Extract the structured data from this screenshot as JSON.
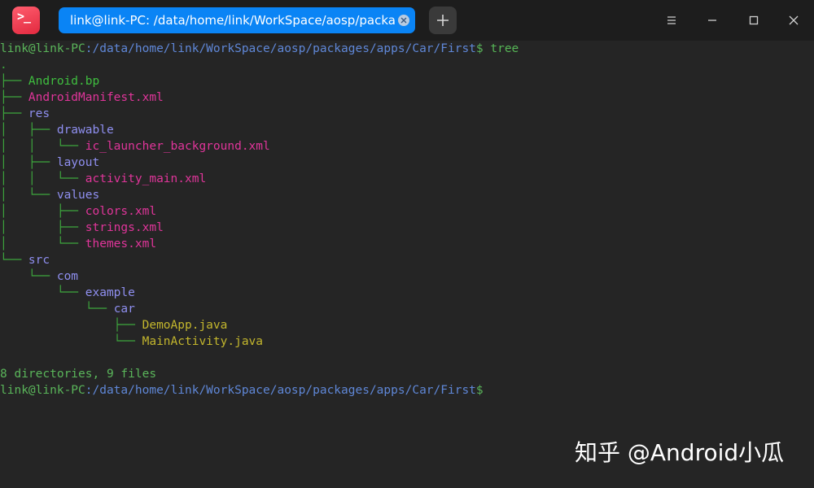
{
  "titlebar": {
    "tab_title": "link@link-PC: /data/home/link/WorkSpace/aosp/packages/a…",
    "app_icon_glyph": ">_",
    "icons": {
      "app": "terminal-icon",
      "tab_close": "close-icon",
      "add_tab": "plus-icon",
      "menu": "menu-icon",
      "minimize": "minimize-icon",
      "maximize": "maximize-icon",
      "close": "close-icon"
    },
    "accent_color": "#0a84f5"
  },
  "terminal": {
    "prompt_user": "link@link-PC",
    "prompt_path": ":/data/home/link/WorkSpace/aosp/packages/apps/Car/First",
    "prompt_symbol": "$",
    "command": " tree",
    "tree_root": ".",
    "tree": [
      {
        "branch": "├── ",
        "name": "Android.bp",
        "kind": "bp"
      },
      {
        "branch": "├── ",
        "name": "AndroidManifest.xml",
        "kind": "xml"
      },
      {
        "branch": "├── ",
        "name": "res",
        "kind": "dir"
      },
      {
        "branch": "│   ├── ",
        "name": "drawable",
        "kind": "dir"
      },
      {
        "branch": "│   │   └── ",
        "name": "ic_launcher_background.xml",
        "kind": "xml"
      },
      {
        "branch": "│   ├── ",
        "name": "layout",
        "kind": "dir"
      },
      {
        "branch": "│   │   └── ",
        "name": "activity_main.xml",
        "kind": "xml"
      },
      {
        "branch": "│   └── ",
        "name": "values",
        "kind": "dir"
      },
      {
        "branch": "│       ├── ",
        "name": "colors.xml",
        "kind": "xml"
      },
      {
        "branch": "│       ├── ",
        "name": "strings.xml",
        "kind": "xml"
      },
      {
        "branch": "│       └── ",
        "name": "themes.xml",
        "kind": "xml"
      },
      {
        "branch": "└── ",
        "name": "src",
        "kind": "dir"
      },
      {
        "branch": "    └── ",
        "name": "com",
        "kind": "dir"
      },
      {
        "branch": "        └── ",
        "name": "example",
        "kind": "dir"
      },
      {
        "branch": "            └── ",
        "name": "car",
        "kind": "dir"
      },
      {
        "branch": "                ├── ",
        "name": "DemoApp.java",
        "kind": "java"
      },
      {
        "branch": "                └── ",
        "name": "MainActivity.java",
        "kind": "java"
      }
    ],
    "summary": "8 directories, 9 files",
    "colors": {
      "user": "#5ab55a",
      "path": "#5f87d7",
      "tree_lines": "#3ea83e",
      "directory": "#8f8ff0",
      "xml": "#e0359a",
      "java": "#c3b62d",
      "background": "#252525"
    }
  },
  "watermark": "知乎 @Android小瓜"
}
